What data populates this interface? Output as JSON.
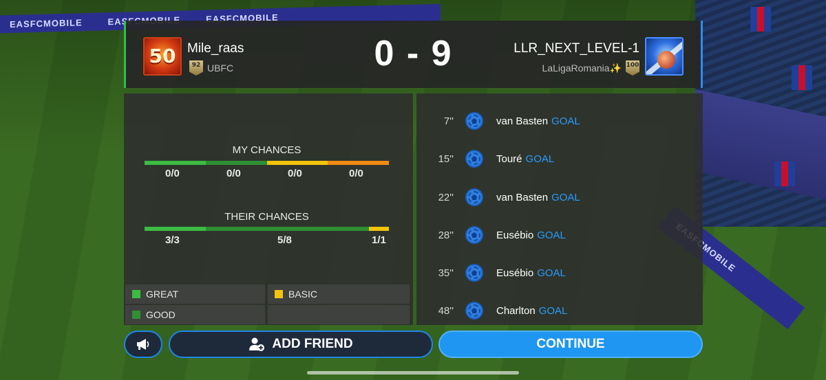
{
  "background": {
    "banner_text": "EASFCMOBILE",
    "side_banner_text": "EASFCMOBILE"
  },
  "header": {
    "left": {
      "badge": "50",
      "name": "Mile_raas",
      "ovr": "92",
      "club": "UBFC"
    },
    "score": "0 - 9",
    "right": {
      "name": "LLR_NEXT_LEVEL-1",
      "club": "LaLigaRomania✨",
      "ovr": "100"
    }
  },
  "my_chances": {
    "title": "MY CHANCES",
    "segments": [
      {
        "color": "#3dbb43",
        "share": 0.25
      },
      {
        "color": "#2e8f35",
        "share": 0.25
      },
      {
        "color": "#f2c40c",
        "share": 0.25
      },
      {
        "color": "#f08a12",
        "share": 0.25
      }
    ],
    "values": [
      "0/0",
      "0/0",
      "0/0",
      "0/0"
    ]
  },
  "their_chances": {
    "title": "THEIR CHANCES",
    "segments": [
      {
        "color": "#3dbb43",
        "share": 0.25
      },
      {
        "color": "#2e8f35",
        "share": 0.667
      },
      {
        "color": "#f2c40c",
        "share": 0.083
      }
    ],
    "values": [
      "3/3",
      "5/8",
      "1/1"
    ]
  },
  "legend": [
    {
      "label": "GREAT",
      "color": "#3dbb43"
    },
    {
      "label": "BASIC",
      "color": "#f2c40c"
    },
    {
      "label": "GOOD",
      "color": "#2e8f35"
    }
  ],
  "events": [
    {
      "minute": "7''",
      "player": "van Basten",
      "type": "GOAL",
      "icon": "ball-icon"
    },
    {
      "minute": "15''",
      "player": "Touré",
      "type": "GOAL",
      "icon": "ball-icon"
    },
    {
      "minute": "22''",
      "player": "van Basten",
      "type": "GOAL",
      "icon": "ball-icon"
    },
    {
      "minute": "28''",
      "player": "Eusébio",
      "type": "GOAL",
      "icon": "ball-icon"
    },
    {
      "minute": "35''",
      "player": "Eusébio",
      "type": "GOAL",
      "icon": "ball-icon"
    },
    {
      "minute": "48''",
      "player": "Charlton",
      "type": "GOAL",
      "icon": "ball-icon"
    }
  ],
  "buttons": {
    "announce_icon": "megaphone-icon",
    "add_friend": "ADD FRIEND",
    "add_friend_icon": "add-user-icon",
    "continue": "CONTINUE"
  },
  "colors": {
    "accent_blue": "#1f96f2",
    "goal_text": "#2a9bff",
    "home_border": "#2fc14a",
    "away_border": "#2a8cff"
  }
}
